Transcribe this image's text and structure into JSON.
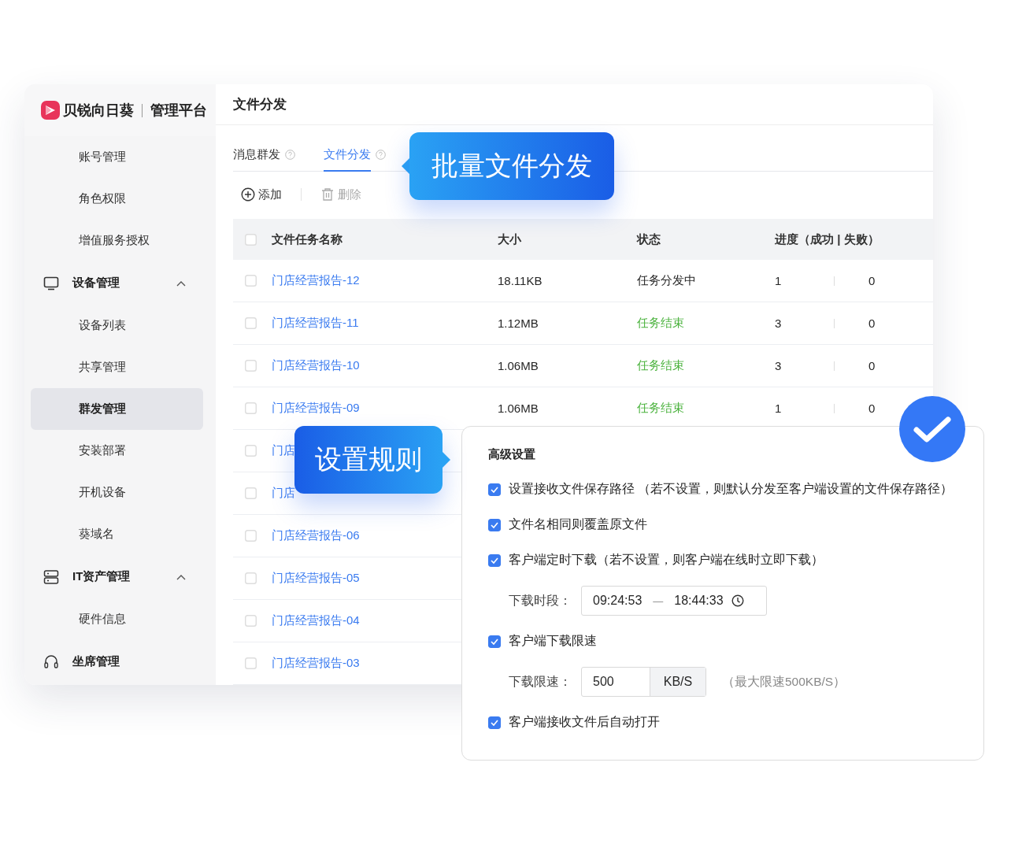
{
  "brand": {
    "name": "贝锐向日葵",
    "suffix": "管理平台"
  },
  "sidebar": {
    "items": [
      {
        "label": "账号管理",
        "kind": "item",
        "selected": false
      },
      {
        "label": "角色权限",
        "kind": "item",
        "selected": false
      },
      {
        "label": "增值服务授权",
        "kind": "item",
        "selected": false
      },
      {
        "label": "设备管理",
        "kind": "group",
        "expanded": true,
        "children": [
          {
            "label": "设备列表",
            "selected": false
          },
          {
            "label": "共享管理",
            "selected": false
          },
          {
            "label": "群发管理",
            "selected": true
          },
          {
            "label": "安装部署",
            "selected": false
          },
          {
            "label": "开机设备",
            "selected": false
          },
          {
            "label": "葵域名",
            "selected": false
          }
        ]
      },
      {
        "label": "IT资产管理",
        "kind": "group",
        "expanded": true,
        "children": [
          {
            "label": "硬件信息",
            "selected": false
          }
        ]
      },
      {
        "label": "坐席管理",
        "kind": "group"
      }
    ]
  },
  "page_title": "文件分发",
  "tabs": [
    {
      "label": "消息群发",
      "selected": false
    },
    {
      "label": "文件分发",
      "selected": true
    }
  ],
  "toolbar": [
    {
      "label": "添加",
      "disabled": false
    },
    {
      "label": "删除",
      "disabled": true
    }
  ],
  "table": {
    "select_all_checked": false,
    "columns": [
      "文件任务名称",
      "大小",
      "状态",
      "进度（成功 | 失败）"
    ],
    "rows": [
      {
        "checked": false,
        "name": "门店经营报告-12",
        "size": "18.11KB",
        "status": {
          "text": "任务分发中",
          "color": "#262626"
        },
        "success": "1",
        "failed": "0"
      },
      {
        "checked": false,
        "name": "门店经营报告-11",
        "size": "1.12MB",
        "status": {
          "text": "任务结束",
          "color": "#4cb33f"
        },
        "success": "3",
        "failed": "0"
      },
      {
        "checked": false,
        "name": "门店经营报告-10",
        "size": "1.06MB",
        "status": {
          "text": "任务结束",
          "color": "#4cb33f"
        },
        "success": "3",
        "failed": "0"
      },
      {
        "checked": false,
        "name": "门店经营报告-09",
        "size": "1.06MB",
        "status": {
          "text": "任务结束",
          "color": "#4cb33f"
        },
        "success": "1",
        "failed": "0"
      },
      {
        "checked": false,
        "name": "门店"
      },
      {
        "checked": false,
        "name": "门店"
      },
      {
        "checked": false,
        "name": "门店经营报告-06"
      },
      {
        "checked": false,
        "name": "门店经营报告-05"
      },
      {
        "checked": false,
        "name": "门店经营报告-04"
      },
      {
        "checked": false,
        "name": "门店经营报告-03"
      }
    ]
  },
  "callouts": [
    {
      "text": "批量文件分发"
    },
    {
      "text": "设置规则"
    }
  ],
  "settings": {
    "title": "高级设置",
    "items": [
      {
        "kind": "checkbox",
        "label": "设置接收文件保存路径 （若不设置，则默认分发至客户端设置的文件保存路径）",
        "checked": true
      },
      {
        "kind": "checkbox",
        "label": "文件名相同则覆盖原文件",
        "checked": true
      },
      {
        "kind": "checkbox",
        "label": "客户端定时下载（若不设置，则客户端在线时立即下载）",
        "checked": true
      },
      {
        "kind": "time_range",
        "label": "下载时段：",
        "start": "09:24:53",
        "separator": "—",
        "end": "18:44:33"
      },
      {
        "kind": "checkbox",
        "label": "客户端下载限速",
        "checked": true
      },
      {
        "kind": "speed",
        "label": "下载限速：",
        "value": "500",
        "unit": "KB/S",
        "hint": "（最大限速500KB/S）"
      },
      {
        "kind": "checkbox",
        "label": "客户端接收文件后自动打开",
        "checked": true
      }
    ]
  }
}
